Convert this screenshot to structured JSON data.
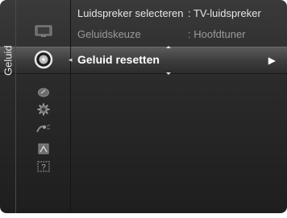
{
  "sidebar": {
    "category_label": "Geluid",
    "icons": [
      {
        "name": "picture-icon"
      },
      {
        "name": "sound-icon"
      },
      {
        "name": "channel-icon"
      },
      {
        "name": "setup-icon"
      },
      {
        "name": "input-icon"
      },
      {
        "name": "application-icon"
      },
      {
        "name": "support-icon"
      }
    ],
    "support_icon_glyph": "?"
  },
  "menu": {
    "items": [
      {
        "label": "Luidspreker selecteren",
        "value": ": TV-luidspreker",
        "state": "normal"
      },
      {
        "label": "Geluidskeuze",
        "value": ": Hoofdtuner",
        "state": "disabled"
      },
      {
        "label": "Geluid resetten",
        "value": "",
        "state": "selected"
      }
    ],
    "selected_arrow": "▶",
    "left_arrow": "◂"
  },
  "colors": {
    "text_normal": "#e6e6e6",
    "text_disabled": "#9a9a9a",
    "text_selected": "#ffffff",
    "background": "#2a2a2a"
  }
}
